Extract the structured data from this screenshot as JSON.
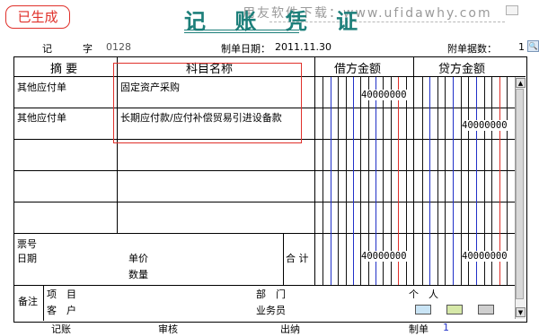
{
  "stamp": "已生成",
  "title": "记 账 凭 证",
  "watermark": "用友软件下载：www.ufidawhy.com",
  "header": {
    "voucher_type": "记",
    "char_label": "字",
    "voucher_no": "0128",
    "date_label": "制单日期：",
    "date_value": "2011.11.30",
    "attach_label": "附单据数：",
    "attach_value": "1"
  },
  "columns": {
    "summary": "摘 要",
    "account": "科目名称",
    "debit": "借方金额",
    "credit": "贷方金额"
  },
  "entries": [
    {
      "summary": "其他应付单",
      "account": "固定资产采购",
      "debit": "40000000",
      "credit": ""
    },
    {
      "summary": "其他应付单",
      "account": "长期应付款/应付补偿贸易引进设备款",
      "debit": "",
      "credit": "40000000"
    }
  ],
  "bottom": {
    "ticket_no": "票号",
    "date": "日期",
    "unit_price": "单价",
    "quantity": "数量",
    "total_label": "合 计",
    "total_debit": "40000000",
    "total_credit": "40000000"
  },
  "remarks": {
    "label": "备注",
    "project": "项　目",
    "department": "部　门",
    "individual": "个　人",
    "customer": "客　户",
    "salesperson": "业务员"
  },
  "footer": {
    "bookkeeper": "记账",
    "auditor": "审核",
    "cashier": "出纳",
    "maker": "制单",
    "maker_value": "1"
  },
  "colors": {
    "stamp": "#e0302a",
    "title": "#1d7f7a",
    "grid_blue": "#2030c8",
    "grid_red": "#e0302a"
  }
}
